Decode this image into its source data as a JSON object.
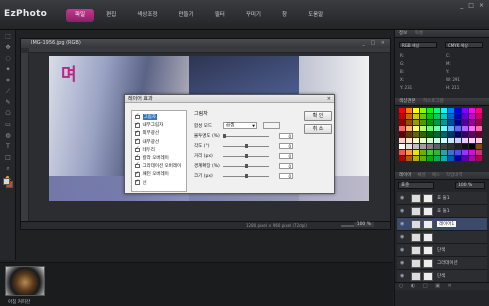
{
  "app": {
    "logo": "EzPhoto",
    "menu": [
      {
        "label": "파일",
        "active": true
      },
      {
        "label": "편집",
        "active": false
      },
      {
        "label": "색상조정",
        "active": false
      },
      {
        "label": "만들기",
        "active": false
      },
      {
        "label": "필터",
        "active": false
      },
      {
        "label": "꾸미기",
        "active": false
      },
      {
        "label": "창",
        "active": false
      },
      {
        "label": "도움말",
        "active": false
      }
    ],
    "window_controls": [
      "_",
      "□",
      "×"
    ]
  },
  "document": {
    "title": "IMG-1956.jpg (RGB)",
    "controls": "_ □ ×",
    "canvas_mark": "며",
    "dimensions": "1280 pixel × 960 pixel (72dpi)",
    "zoom": "100 %"
  },
  "info_panel": {
    "tabs": [
      "정보",
      "픽셀"
    ],
    "mode_left": "RGB 색상",
    "mode_right": "CMYK 색상",
    "rows": [
      [
        "R:",
        "C:"
      ],
      [
        "G:",
        "M:"
      ],
      [
        "B:",
        "Y:"
      ],
      [
        "X:",
        "W: 291"
      ],
      [
        "Y: 231",
        "H: 211"
      ]
    ]
  },
  "swatch_panel": {
    "tabs": [
      "색상견본",
      "히스토그램"
    ],
    "colors": [
      "#ff0000",
      "#ff8000",
      "#ffff00",
      "#80ff00",
      "#00ff00",
      "#00ff80",
      "#00ffff",
      "#0080ff",
      "#0000ff",
      "#8000ff",
      "#ff00ff",
      "#ff0080",
      "#cc0000",
      "#cc6600",
      "#cccc00",
      "#66cc00",
      "#00cc00",
      "#00cc66",
      "#00cccc",
      "#0066cc",
      "#0000cc",
      "#6600cc",
      "#cc00cc",
      "#cc0066",
      "#990000",
      "#994c00",
      "#999900",
      "#4c9900",
      "#009900",
      "#00994c",
      "#009999",
      "#004c99",
      "#000099",
      "#4c0099",
      "#990099",
      "#99004c",
      "#ff6666",
      "#ffb366",
      "#ffff66",
      "#b3ff66",
      "#66ff66",
      "#66ffb3",
      "#66ffff",
      "#66b3ff",
      "#6666ff",
      "#b366ff",
      "#ff66ff",
      "#ff66b3",
      "#660000",
      "#663300",
      "#666600",
      "#336600",
      "#006600",
      "#006633",
      "#006666",
      "#003366",
      "#000066",
      "#330066",
      "#660066",
      "#660033",
      "#ffcccc",
      "#ffe5cc",
      "#ffffcc",
      "#e5ffcc",
      "#ccffcc",
      "#ccffe5",
      "#ccffff",
      "#cce5ff",
      "#ccccff",
      "#e5ccff",
      "#ffccff",
      "#ffcce5",
      "#ffffff",
      "#e0e0e0",
      "#c0c0c0",
      "#a0a0a0",
      "#808080",
      "#606060",
      "#404040",
      "#303030",
      "#202020",
      "#101010",
      "#000000",
      "#8b4513",
      "#ff4d4d",
      "#ff9933",
      "#e6e600",
      "#66b300",
      "#33cc33",
      "#2eb82e",
      "#29a3a3",
      "#3377cc",
      "#4d4dff",
      "#9933ff",
      "#e600e6",
      "#cc3377",
      "#b30000",
      "#b35900",
      "#b3b300",
      "#59b300",
      "#00b300",
      "#00b359",
      "#00b3b3",
      "#0059b3",
      "#0000b3",
      "#5900b3",
      "#b300b3",
      "#b30059"
    ]
  },
  "layers_panel": {
    "tabs": [
      "레이어",
      "채널",
      "패스",
      "작업내역"
    ],
    "blend_mode": "표준",
    "opacity": "100 %",
    "layers": [
      {
        "name": "효 둘1",
        "selected": false
      },
      {
        "name": "효 둘1",
        "selected": false
      },
      {
        "name": "레이어1",
        "selected": true
      },
      {
        "name": "",
        "selected": false
      },
      {
        "name": "단색",
        "selected": false
      },
      {
        "name": "그라데이션",
        "selected": false
      },
      {
        "name": "단색",
        "selected": false
      }
    ],
    "footer_icons": "○ ◐ □ ▣ ✕"
  },
  "filmstrip": {
    "thumb_label": "아침 커피잔"
  },
  "dialog": {
    "title": "레이어 효과",
    "close": "×",
    "effects": [
      {
        "label": "그림자",
        "checked": true,
        "selected": true
      },
      {
        "label": "내부그림자",
        "checked": true,
        "selected": false
      },
      {
        "label": "외부광선",
        "checked": true,
        "selected": false
      },
      {
        "label": "내부광선",
        "checked": true,
        "selected": false
      },
      {
        "label": "테두리",
        "checked": true,
        "selected": false
      },
      {
        "label": "칼라 오버레이",
        "checked": true,
        "selected": false
      },
      {
        "label": "그라데이션 오버레이",
        "checked": true,
        "selected": false
      },
      {
        "label": "패턴 오버레이",
        "checked": true,
        "selected": false
      },
      {
        "label": "선",
        "checked": true,
        "selected": false
      }
    ],
    "settings_heading": "그림자",
    "blend_label": "합성 모드",
    "blend_value": "곱셈",
    "params": [
      {
        "label": "불투명도 (%)",
        "value": "0",
        "level": 0.0
      },
      {
        "label": "각도 (°)",
        "value": "0",
        "level": 0.5
      },
      {
        "label": "거리 (px)",
        "value": "0",
        "level": 0.5
      },
      {
        "label": "경계확장 (%)",
        "value": "0",
        "level": 0.5
      },
      {
        "label": "크기 (px)",
        "value": "0",
        "level": 0.5
      }
    ],
    "ok_label": "확 인",
    "cancel_label": "취 소"
  }
}
